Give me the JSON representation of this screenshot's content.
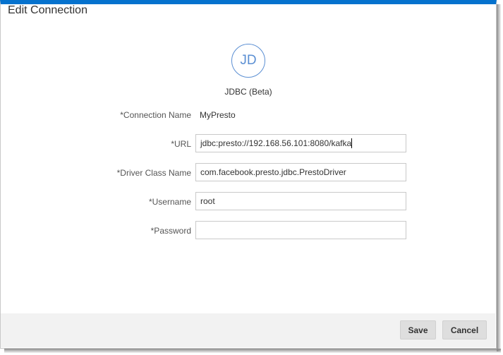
{
  "dialog": {
    "title": "Edit Connection",
    "accent_color": "#0572ce"
  },
  "connection": {
    "avatar_initials": "JD",
    "type_label": "JDBC (Beta)"
  },
  "form": {
    "connection_name": {
      "label": "*Connection Name",
      "value": "MyPresto"
    },
    "url": {
      "label": "*URL",
      "value": "jdbc:presto://192.168.56.101:8080/kafka"
    },
    "driver_class": {
      "label": "*Driver Class Name",
      "value": "com.facebook.presto.jdbc.PrestoDriver"
    },
    "username": {
      "label": "*Username",
      "value": "root"
    },
    "password": {
      "label": "*Password",
      "value": ""
    }
  },
  "footer": {
    "save_label": "Save",
    "cancel_label": "Cancel"
  }
}
